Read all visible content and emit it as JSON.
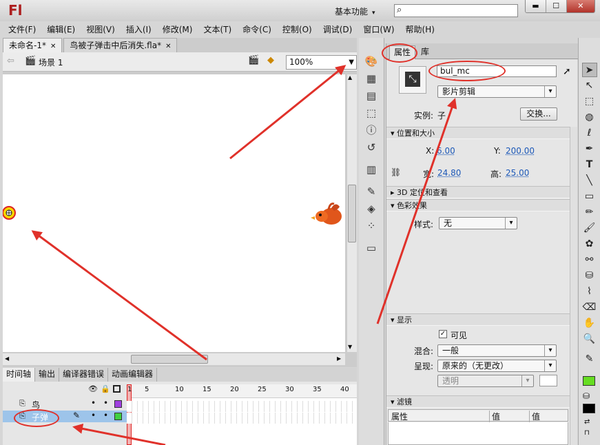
{
  "app": {
    "logo": "Fl",
    "workspace": "基本功能",
    "search_placeholder": ""
  },
  "menu": [
    "文件(F)",
    "编辑(E)",
    "视图(V)",
    "插入(I)",
    "修改(M)",
    "文本(T)",
    "命令(C)",
    "控制(O)",
    "调试(D)",
    "窗口(W)",
    "帮助(H)"
  ],
  "doc_tabs": [
    {
      "label": "未命名-1*",
      "active": true
    },
    {
      "label": "鸟被子弹击中后消失.fla*",
      "active": false
    }
  ],
  "scene": {
    "label": "场景 1",
    "zoom": "100%"
  },
  "timeline": {
    "tabs": [
      "时间轴",
      "输出",
      "编译器错误",
      "动画编辑器"
    ],
    "frame_numbers": [
      "1",
      "5",
      "10",
      "15",
      "20",
      "25",
      "30",
      "35",
      "40"
    ],
    "layers": [
      {
        "name": "鸟",
        "selected": false,
        "color": "#a040e0"
      },
      {
        "name": "子弹",
        "selected": true,
        "color": "#40d040"
      }
    ]
  },
  "properties": {
    "tabs": [
      "属性",
      "库"
    ],
    "instance_name": "bul_mc",
    "symbol_type": "影片剪辑",
    "instance_label": "实例:",
    "instance_value": "子",
    "swap_button": "交换...",
    "position_section": "位置和大小",
    "x_label": "X:",
    "x_value": "6.00",
    "y_label": "Y:",
    "y_value": "200.00",
    "w_label": "宽:",
    "w_value": "24.80",
    "h_label": "高:",
    "h_value": "25.00",
    "three_d_section": "3D 定位和查看",
    "color_section": "色彩效果",
    "style_label": "样式:",
    "style_value": "无",
    "display_section": "显示",
    "visible_label": "可见",
    "blend_label": "混合:",
    "blend_value": "一般",
    "render_label": "呈现:",
    "render_value": "原来的（无更改）",
    "transparent_value": "透明",
    "filters_section": "滤镜",
    "filter_cols": [
      "属性",
      "值",
      "值"
    ]
  },
  "colors": {
    "annotation": "#e0312a",
    "stroke_swatch": "#000000",
    "fill_swatch": "#66dd22"
  }
}
